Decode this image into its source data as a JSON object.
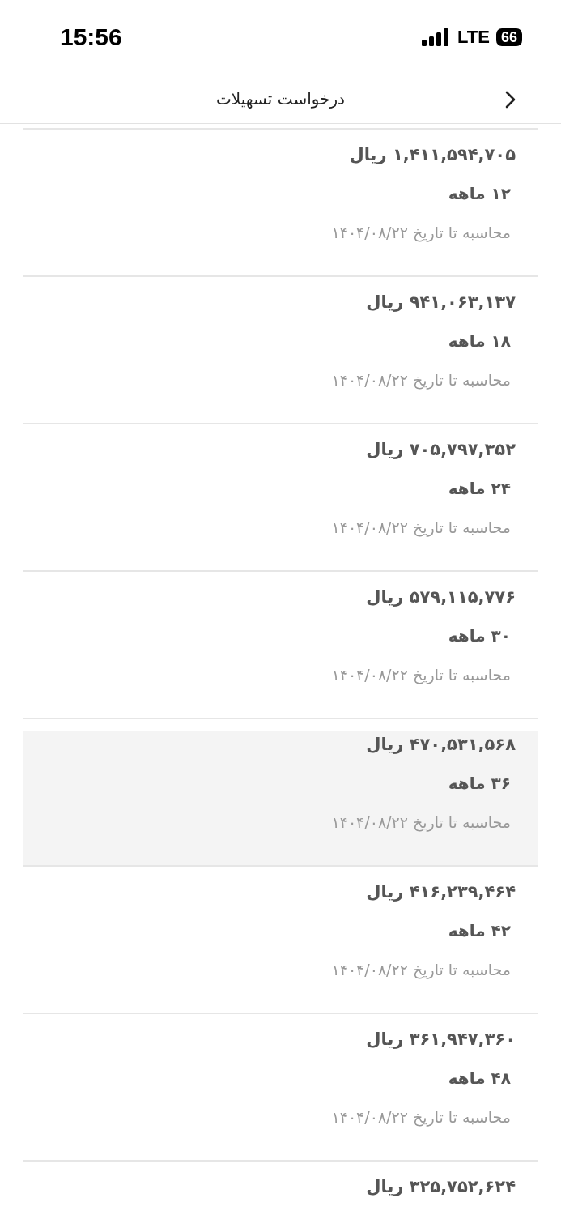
{
  "status_bar": {
    "time": "15:56",
    "network": "LTE",
    "battery": "66"
  },
  "header": {
    "title": "درخواست تسهیلات"
  },
  "items": [
    {
      "amount": "۱,۴۱۱,۵۹۴,۷۰۵ ریال",
      "term": "۱۲ ماهه",
      "note": "محاسبه تا تاریخ ۱۴۰۴/۰۸/۲۲",
      "selected": false
    },
    {
      "amount": "۹۴۱,۰۶۳,۱۳۷ ریال",
      "term": "۱۸ ماهه",
      "note": "محاسبه تا تاریخ ۱۴۰۴/۰۸/۲۲",
      "selected": false
    },
    {
      "amount": "۷۰۵,۷۹۷,۳۵۲ ریال",
      "term": "۲۴ ماهه",
      "note": "محاسبه تا تاریخ ۱۴۰۴/۰۸/۲۲",
      "selected": false
    },
    {
      "amount": "۵۷۹,۱۱۵,۷۷۶ ریال",
      "term": "۳۰ ماهه",
      "note": "محاسبه تا تاریخ ۱۴۰۴/۰۸/۲۲",
      "selected": false
    },
    {
      "amount": "۴۷۰,۵۳۱,۵۶۸ ریال",
      "term": "۳۶ ماهه",
      "note": "محاسبه تا تاریخ ۱۴۰۴/۰۸/۲۲",
      "selected": true
    },
    {
      "amount": "۴۱۶,۲۳۹,۴۶۴ ریال",
      "term": "۴۲ ماهه",
      "note": "محاسبه تا تاریخ ۱۴۰۴/۰۸/۲۲",
      "selected": false
    },
    {
      "amount": "۳۶۱,۹۴۷,۳۶۰ ریال",
      "term": "۴۸ ماهه",
      "note": "محاسبه تا تاریخ ۱۴۰۴/۰۸/۲۲",
      "selected": false
    },
    {
      "amount": "۳۲۵,۷۵۲,۶۲۴ ریال",
      "selected": false
    }
  ]
}
